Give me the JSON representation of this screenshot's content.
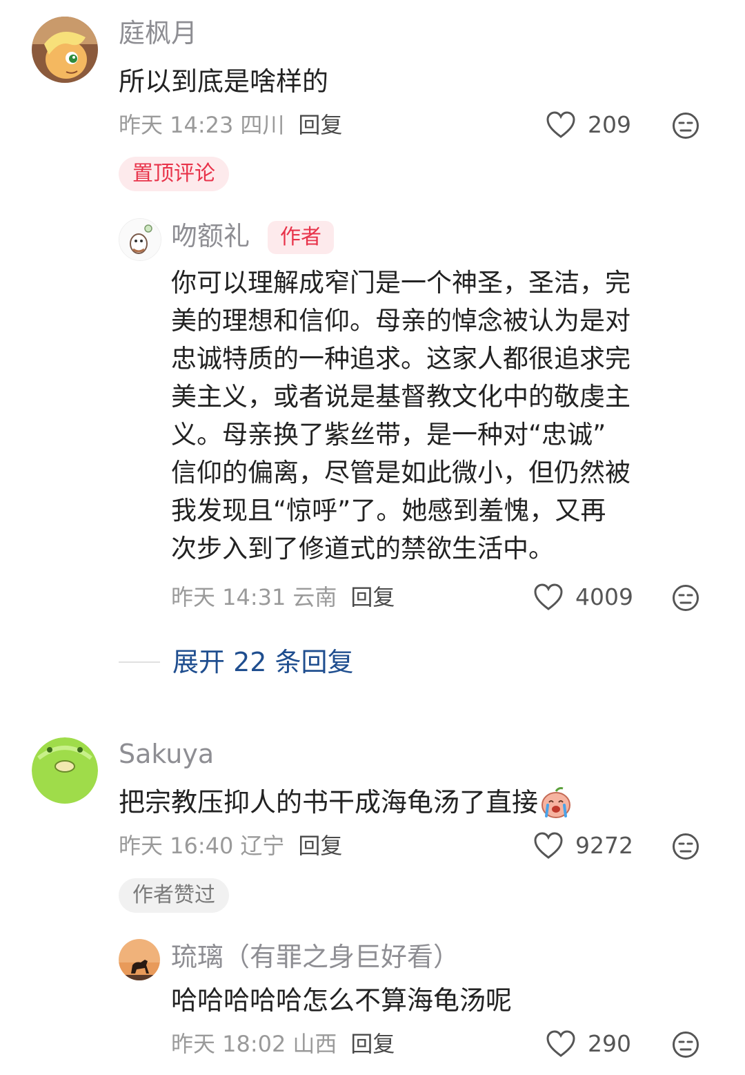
{
  "comments": [
    {
      "username": "庭枫月",
      "text": "所以到底是啥样的",
      "time": "昨天 14:23",
      "location": "四川",
      "reply_label": "回复",
      "likes": "209",
      "badge": "置顶评论",
      "avatar_icon": "pony-avatar-icon",
      "replies": [
        {
          "username": "吻额礼",
          "author_tag": "作者",
          "text_lines": [
            "你可以理解成窄门是一个神圣，圣洁，完",
            "美的理想和信仰。母亲的悼念被认为是对",
            "忠诚特质的一种追求。这家人都很追求完",
            "美主义，或者说是基督教文化中的敬虔主",
            "义。母亲换了紫丝带，是一种对“忠诚”",
            "信仰的偏离，尽管是如此微小，但仍然被",
            "我发现且“惊呼”了。她感到羞愧，又再",
            "次步入到了修道式的禁欲生活中。"
          ],
          "time": "昨天 14:31",
          "location": "云南",
          "reply_label": "回复",
          "likes": "4009"
        }
      ],
      "expand_label": "展开 22 条回复"
    },
    {
      "username": "Sakuya",
      "text": "把宗教压抑人的书干成海龟汤了直接",
      "emoji": "crying-laughing-emoji-icon",
      "time": "昨天 16:40",
      "location": "辽宁",
      "reply_label": "回复",
      "likes": "9272",
      "badge": "作者赞过",
      "replies": [
        {
          "username": "琉璃（有罪之身巨好看）",
          "text": "哈哈哈哈哈怎么不算海龟汤呢",
          "time": "昨天 18:02",
          "location": "山西",
          "reply_label": "回复",
          "likes": "290"
        }
      ]
    }
  ],
  "colors": {
    "tag_red": "#e8334a",
    "link_blue": "#1f4e8f",
    "meta_gray": "#9a9a9a"
  }
}
